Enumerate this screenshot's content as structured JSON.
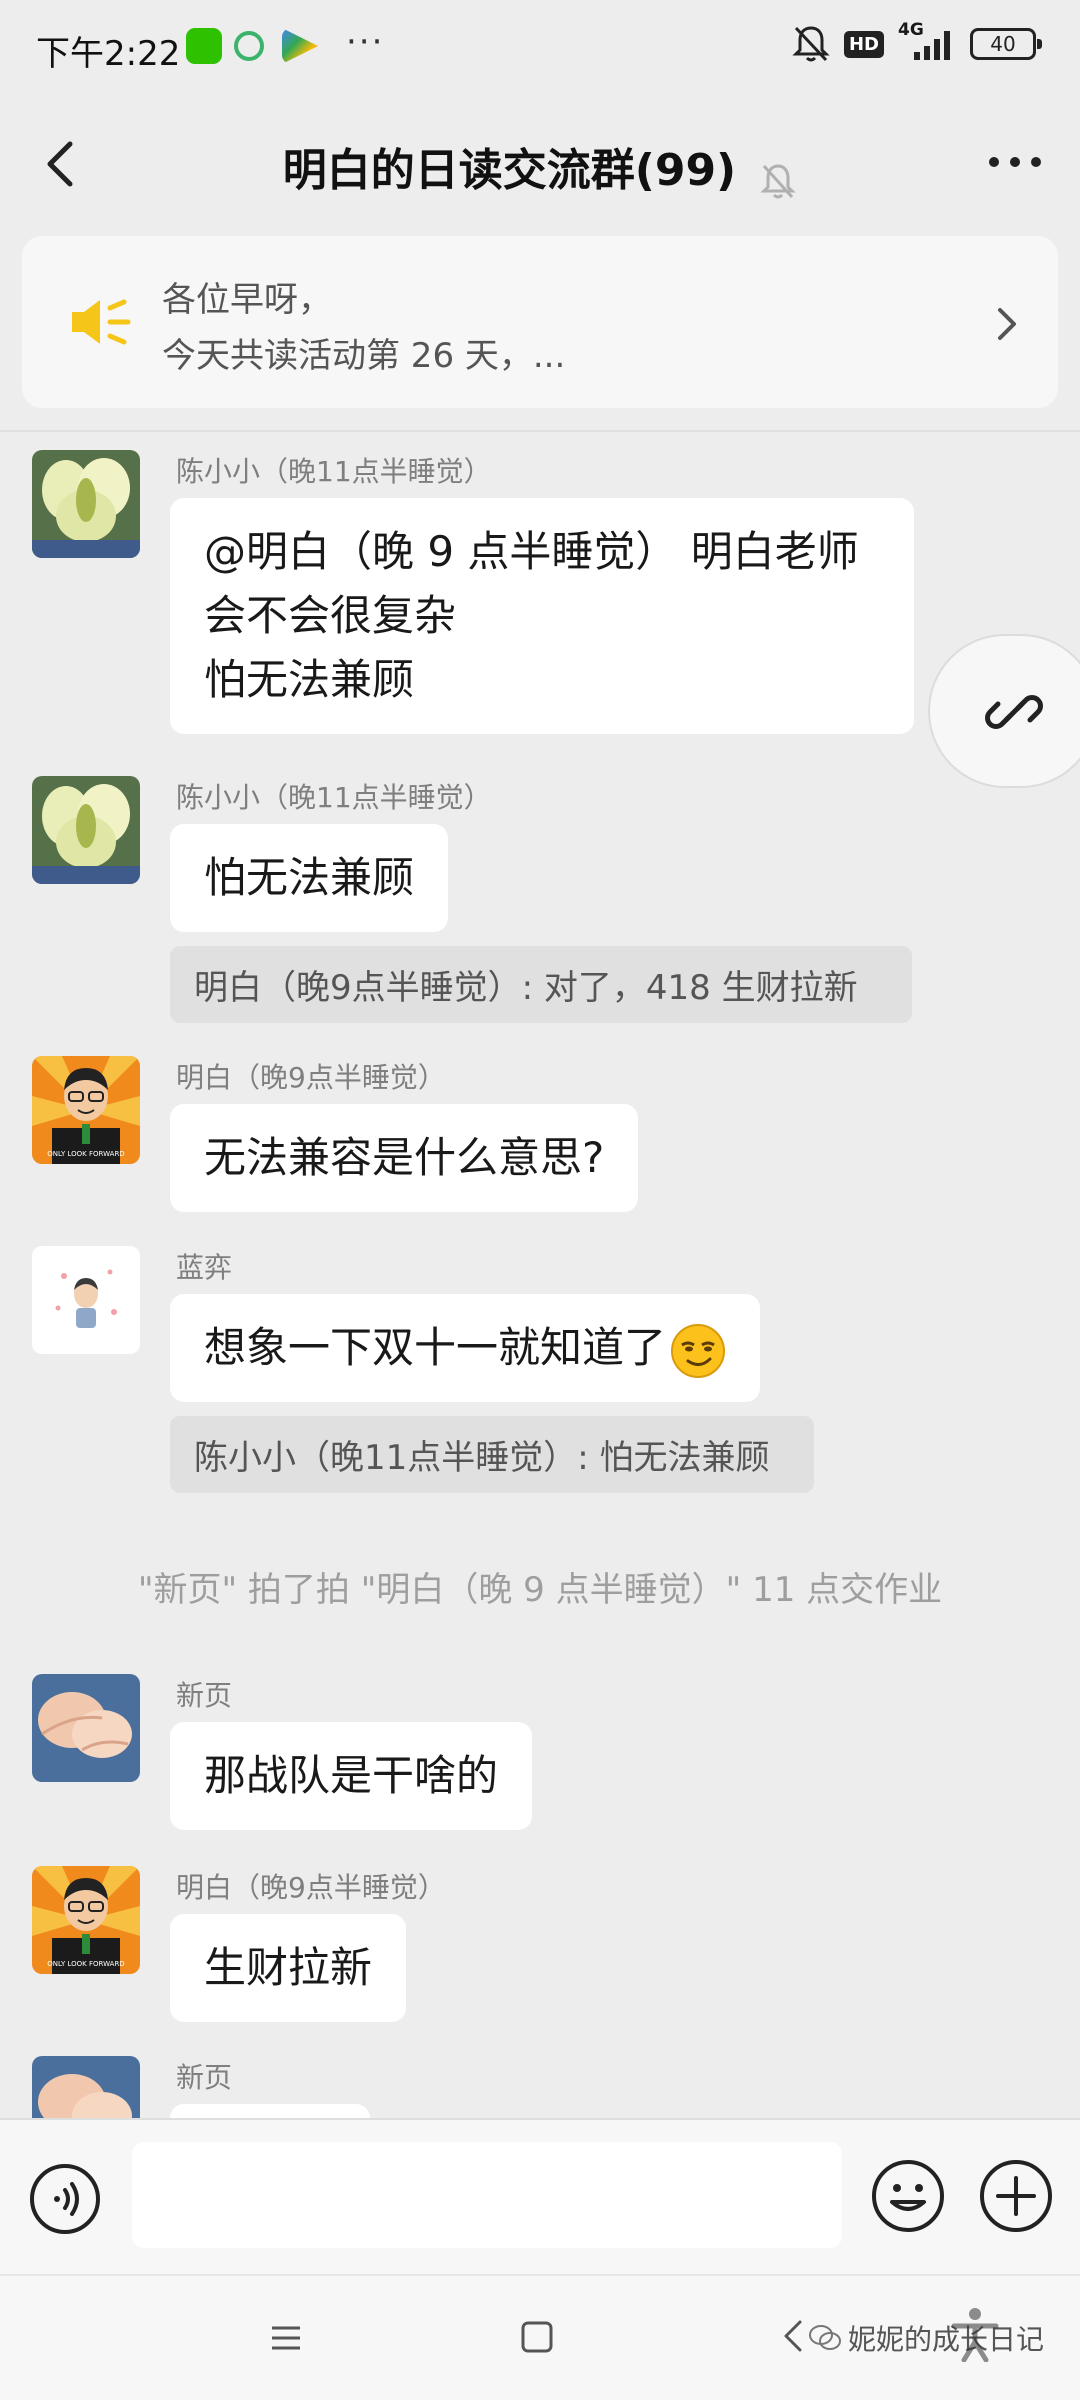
{
  "status_bar": {
    "time": "下午2:22",
    "network": "4G",
    "battery": "40",
    "hd": "HD",
    "more": "···"
  },
  "header": {
    "title": "明白的日读交流群(99)"
  },
  "announcement": {
    "line1": "各位早呀，",
    "line2": "今天共读活动第 26 天，..."
  },
  "messages": [
    {
      "sender": "陈小小（晚11点半睡觉）",
      "lines": [
        "@明白（晚 9 点半睡觉） 明白老师",
        "会不会很复杂",
        "怕无法兼顾"
      ]
    },
    {
      "sender": "陈小小（晚11点半睡觉）",
      "lines": [
        "怕无法兼顾"
      ],
      "quote": "明白（晚9点半睡觉）: 对了，418 生财拉新"
    },
    {
      "sender": "明白（晚9点半睡觉）",
      "lines": [
        "无法兼容是什么意思?"
      ]
    },
    {
      "sender": "蓝弈",
      "lines": [
        "想象一下双十一就知道了"
      ],
      "quote": "陈小小（晚11点半睡觉）: 怕无法兼顾"
    },
    {
      "sender": "新页",
      "lines": [
        "那战队是干啥的"
      ]
    },
    {
      "sender": "明白（晚9点半睡觉）",
      "lines": [
        "生财拉新"
      ]
    },
    {
      "sender": "新页",
      "lines": []
    }
  ],
  "system_message": "\"新页\" 拍了拍 \"明白（晚 9 点半睡觉）\" 11 点交作业",
  "avatar_text": "ONLY LOOK FORWARD",
  "watermark": "妮妮的成长日记",
  "icons": {
    "back": "chevron-left-icon",
    "mute": "bell-off-icon",
    "more": "more-dots-icon",
    "announcement": "speaker-icon",
    "link": "link-icon",
    "voice": "voice-icon",
    "emoji": "emoji-icon",
    "plus": "plus-icon"
  },
  "colors": {
    "background": "#ededed",
    "bubble": "#ffffff",
    "quote": "#e0e0e0",
    "announcement_icon": "#f5c518",
    "sender": "#7f7f7f",
    "system_text": "#9e9e9e"
  }
}
